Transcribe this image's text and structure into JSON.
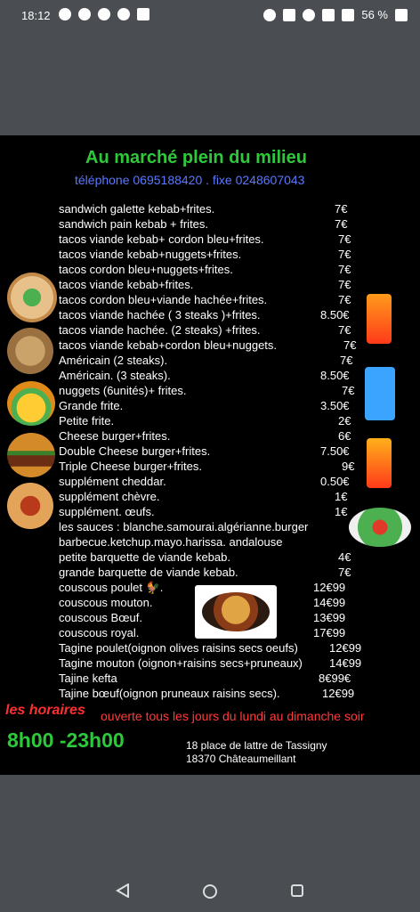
{
  "status_bar": {
    "time": "18:12",
    "battery": "56 %"
  },
  "menu": {
    "title": "Au marché plein du milieu",
    "phone": "téléphone 0695188420 . fixe 0248607043",
    "items": [
      {
        "name": "sandwich galette kebab+frites.",
        "price": "7€"
      },
      {
        "name": "sandwich pain kebab + frites.",
        "price": "7€"
      },
      {
        "name": "tacos viande kebab+ cordon bleu+frites.",
        "price": "7€"
      },
      {
        "name": "tacos viande kebab+nuggets+frites.",
        "price": "7€"
      },
      {
        "name": "tacos cordon bleu+nuggets+frites.",
        "price": "7€"
      },
      {
        "name": "tacos viande kebab+frites.",
        "price": "7€"
      },
      {
        "name": "tacos cordon bleu+viande hachée+frites.",
        "price": "7€"
      },
      {
        "name": "tacos viande hachée ( 3 steaks )+frites.",
        "price": "8.50€"
      },
      {
        "name": "tacos viande hachée. (2 steaks) +frites.",
        "price": "7€"
      },
      {
        "name": "tacos viande kebab+cordon bleu+nuggets.",
        "price": "7€"
      },
      {
        "name": "Américain (2 steaks).",
        "price": "7€"
      },
      {
        "name": "Américain. (3 steaks).",
        "price": "8.50€"
      },
      {
        "name": "nuggets (6unités)+ frites.",
        "price": "7€"
      },
      {
        "name": "Grande frite.",
        "price": "3.50€"
      },
      {
        "name": "Petite frite.",
        "price": "2€"
      },
      {
        "name": "Cheese burger+frites.",
        "price": "6€"
      },
      {
        "name": "Double Cheese burger+frites.",
        "price": "7.50€"
      },
      {
        "name": "Triple Cheese burger+frites.",
        "price": "9€"
      },
      {
        "name": "supplément cheddar.",
        "price": "0.50€"
      },
      {
        "name": "supplément  chèvre.",
        "price": "1€"
      },
      {
        "name": "supplément. œufs.",
        "price": "1€"
      },
      {
        "name": "les sauces : blanche.samourai.algérianne.burger",
        "price": ""
      },
      {
        "name": "barbecue.ketchup.mayo.harissa. andalouse",
        "price": ""
      },
      {
        "name": "petite barquette de viande kebab.",
        "price": "4€"
      },
      {
        "name": "grande barquette de viande kebab.",
        "price": "7€"
      },
      {
        "name": "couscous poulet 🐓.",
        "price": "12€99"
      },
      {
        "name": "couscous mouton.",
        "price": "14€99"
      },
      {
        "name": "couscous Bœuf.",
        "price": "13€99"
      },
      {
        "name": "couscous royal.",
        "price": "17€99"
      },
      {
        "name": "Tagine poulet(oignon olives raisins secs oeufs)",
        "price": "12€99"
      },
      {
        "name": "Tagine mouton (oignon+raisins secs+pruneaux)",
        "price": "14€99"
      },
      {
        "name": "Tajine kefta",
        "price": "8€99€"
      },
      {
        "name": "Tajine bœuf(oignon pruneaux raisins secs).",
        "price": "12€99"
      }
    ],
    "hours_label": "les horaires",
    "open_text": "ouverte tous les jours du lundi au dimanche soir",
    "hours": "8h00 -23h00",
    "address_line1": "18 place de lattre de Tassigny",
    "address_line2": "18370 Châteaumeillant"
  }
}
